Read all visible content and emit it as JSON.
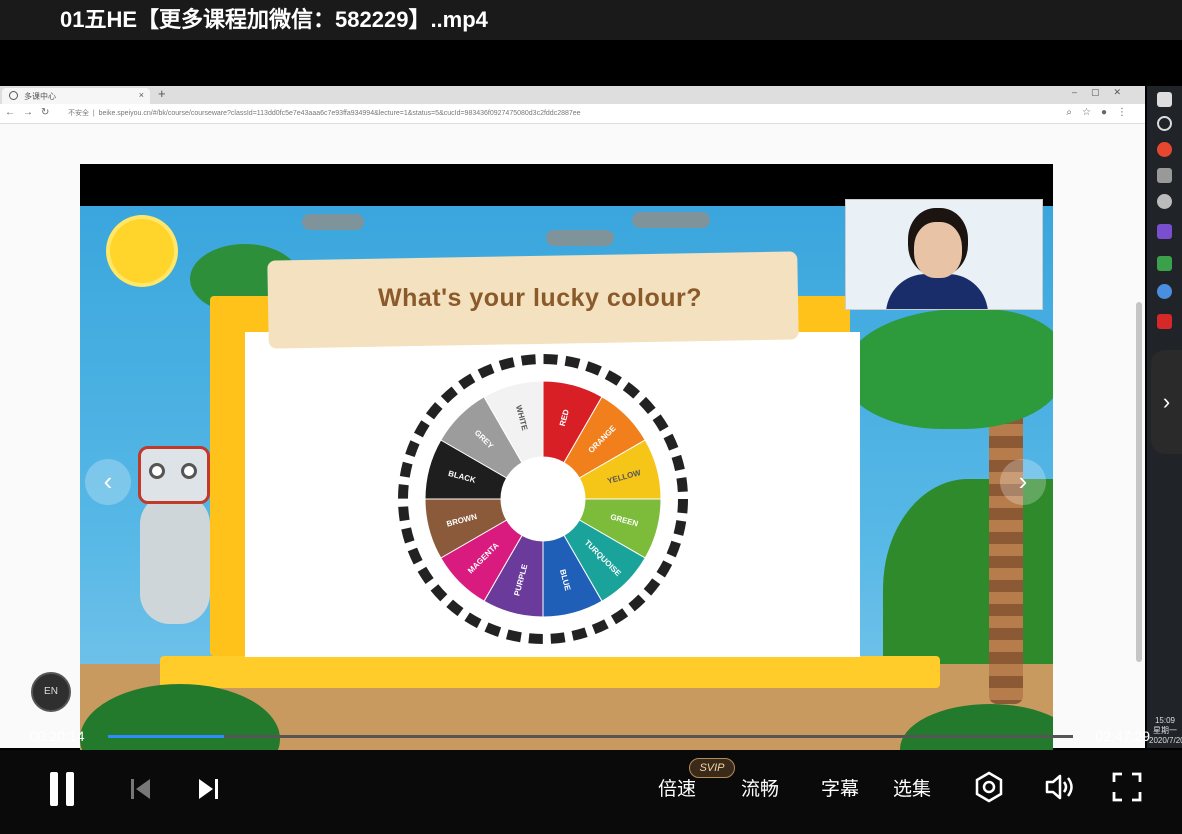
{
  "player": {
    "title": "01五HE【更多课程加微信：582229】..mp4",
    "time_current": "00:20:14",
    "time_total": "02:47:29",
    "progress_fraction": 0.12,
    "controls": {
      "speed_label": "倍速",
      "speed_badge": "SVIP",
      "quality_label": "流畅",
      "subtitle_label": "字幕",
      "episodes_label": "选集"
    },
    "en_badge": "EN"
  },
  "browser": {
    "tab_label": "多课中心",
    "insecure_label": "不安全",
    "url": "beike.speiyou.cn/#/bk/course/courseware?classId=113dd0fc5e7e43aaa6c7e93ffa934994&lecture=1&status=5&cucId=983436f0927475080d3c2fddc2887ee"
  },
  "slide": {
    "title": "What's your lucky colour?",
    "wheel_segments": [
      "RED",
      "ORANGE",
      "YELLOW",
      "GREEN",
      "TURQUOISE",
      "BLUE",
      "PURPLE",
      "MAGENTA",
      "BROWN",
      "BLACK",
      "GREY",
      "WHITE"
    ],
    "wheel_colors": [
      "#d81f26",
      "#f07f1c",
      "#f5c518",
      "#7cbc3a",
      "#1aa39a",
      "#1f5fb8",
      "#6a3b9a",
      "#d91b7f",
      "#8a5a3b",
      "#1e1e1e",
      "#9c9c9c",
      "#f2f2f2"
    ]
  },
  "taskbar": {
    "clock": "15:09",
    "weekday": "星期一",
    "date": "2020/7/20"
  }
}
